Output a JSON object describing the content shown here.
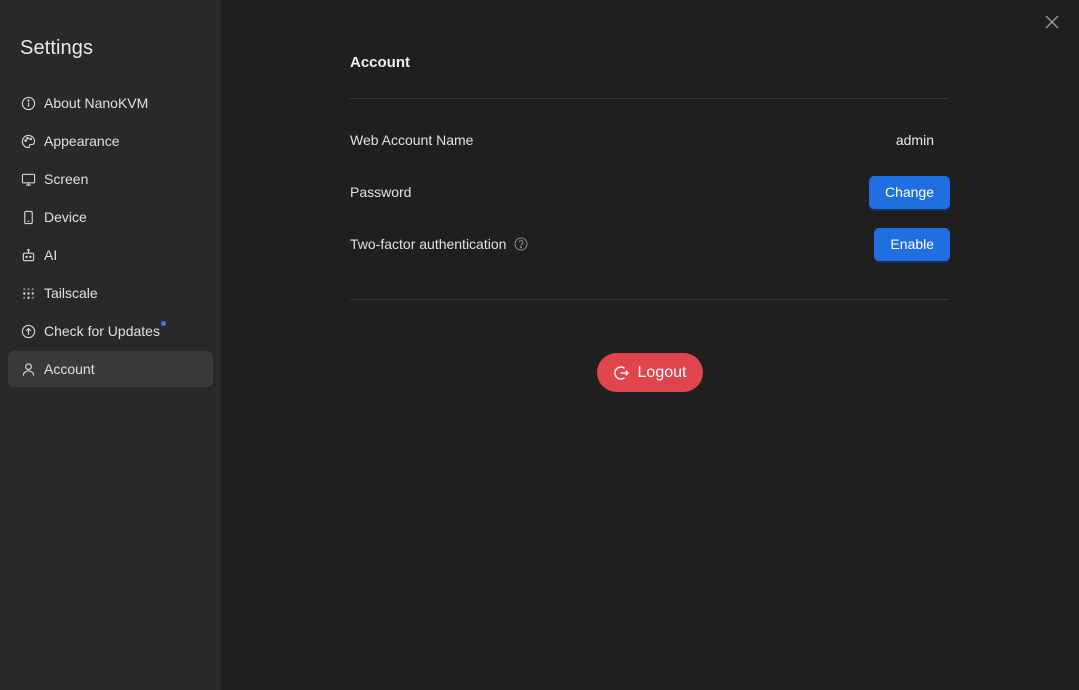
{
  "sidebar": {
    "title": "Settings",
    "items": [
      {
        "label": "About NanoKVM",
        "icon": "info-icon"
      },
      {
        "label": "Appearance",
        "icon": "palette-icon"
      },
      {
        "label": "Screen",
        "icon": "monitor-icon"
      },
      {
        "label": "Device",
        "icon": "phone-icon"
      },
      {
        "label": "AI",
        "icon": "robot-icon"
      },
      {
        "label": "Tailscale",
        "icon": "tailscale-icon"
      },
      {
        "label": "Check for Updates",
        "icon": "upload-circle-icon",
        "badge": "update-dot"
      },
      {
        "label": "Account",
        "icon": "user-icon",
        "active": true
      }
    ]
  },
  "account": {
    "title": "Account",
    "web_account_label": "Web Account Name",
    "web_account_value": "admin",
    "password_label": "Password",
    "password_button": "Change",
    "twofa_label": "Two-factor authentication",
    "twofa_button": "Enable",
    "logout_button": "Logout"
  },
  "colors": {
    "accent_blue": "#1f6fe0",
    "logout_red": "#e0454d",
    "badge_dot": "#2f7bf0"
  }
}
